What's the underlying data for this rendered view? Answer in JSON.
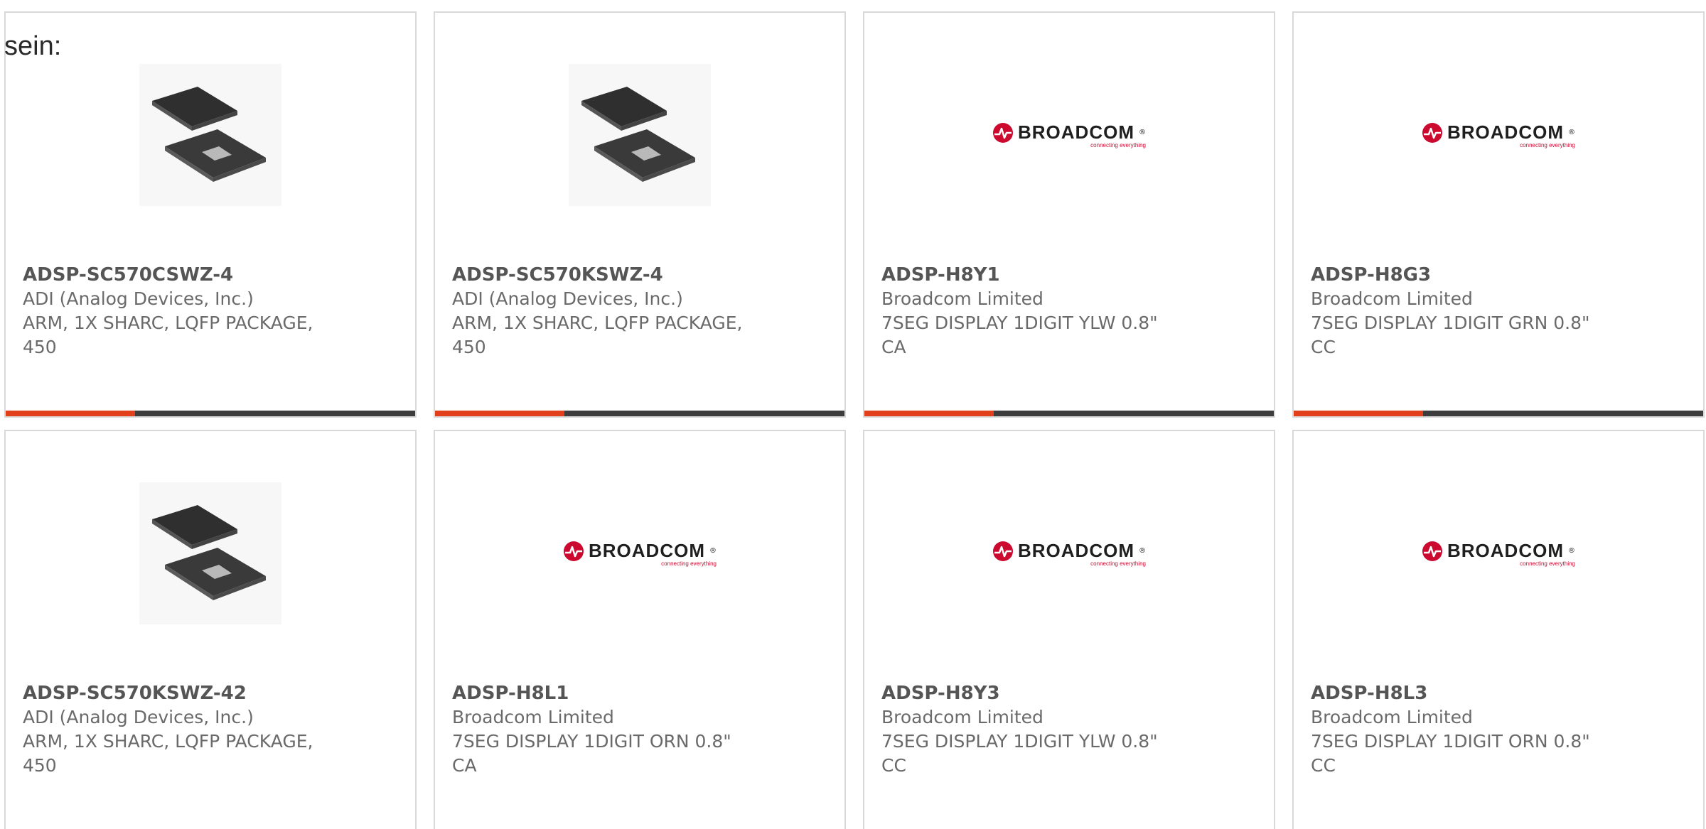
{
  "intro_text": "sein:",
  "brand": {
    "accent_color": "#e2401c",
    "bar_color": "#3d3d3d",
    "broadcom_red": "#cc092f",
    "broadcom_text": "BROADCOM",
    "broadcom_reg": "®",
    "broadcom_tagline": "connecting everything"
  },
  "cards": [
    {
      "part_number": "ADSP-SC570CSWZ-4",
      "manufacturer": "ADI (Analog Devices, Inc.)",
      "description_line1": "ARM, 1X SHARC, LQFP PACKAGE,",
      "description_line2": "450",
      "image": "chip-icon"
    },
    {
      "part_number": "ADSP-SC570KSWZ-4",
      "manufacturer": "ADI (Analog Devices, Inc.)",
      "description_line1": "ARM, 1X SHARC, LQFP PACKAGE,",
      "description_line2": "450",
      "image": "chip-icon"
    },
    {
      "part_number": "ADSP-H8Y1",
      "manufacturer": "Broadcom Limited",
      "description_line1": "7SEG DISPLAY 1DIGIT YLW 0.8\"",
      "description_line2": "CA",
      "image": "broadcom-logo"
    },
    {
      "part_number": "ADSP-H8G3",
      "manufacturer": "Broadcom Limited",
      "description_line1": "7SEG DISPLAY 1DIGIT GRN 0.8\"",
      "description_line2": "CC",
      "image": "broadcom-logo"
    },
    {
      "part_number": "ADSP-SC570KSWZ-42",
      "manufacturer": "ADI (Analog Devices, Inc.)",
      "description_line1": "ARM, 1X SHARC, LQFP PACKAGE,",
      "description_line2": "450",
      "image": "chip-icon"
    },
    {
      "part_number": "ADSP-H8L1",
      "manufacturer": "Broadcom Limited",
      "description_line1": "7SEG DISPLAY 1DIGIT ORN 0.8\"",
      "description_line2": "CA",
      "image": "broadcom-logo"
    },
    {
      "part_number": "ADSP-H8Y3",
      "manufacturer": "Broadcom Limited",
      "description_line1": "7SEG DISPLAY 1DIGIT YLW 0.8\"",
      "description_line2": "CC",
      "image": "broadcom-logo"
    },
    {
      "part_number": "ADSP-H8L3",
      "manufacturer": "Broadcom Limited",
      "description_line1": "7SEG DISPLAY 1DIGIT ORN 0.8\"",
      "description_line2": "CC",
      "image": "broadcom-logo"
    }
  ]
}
